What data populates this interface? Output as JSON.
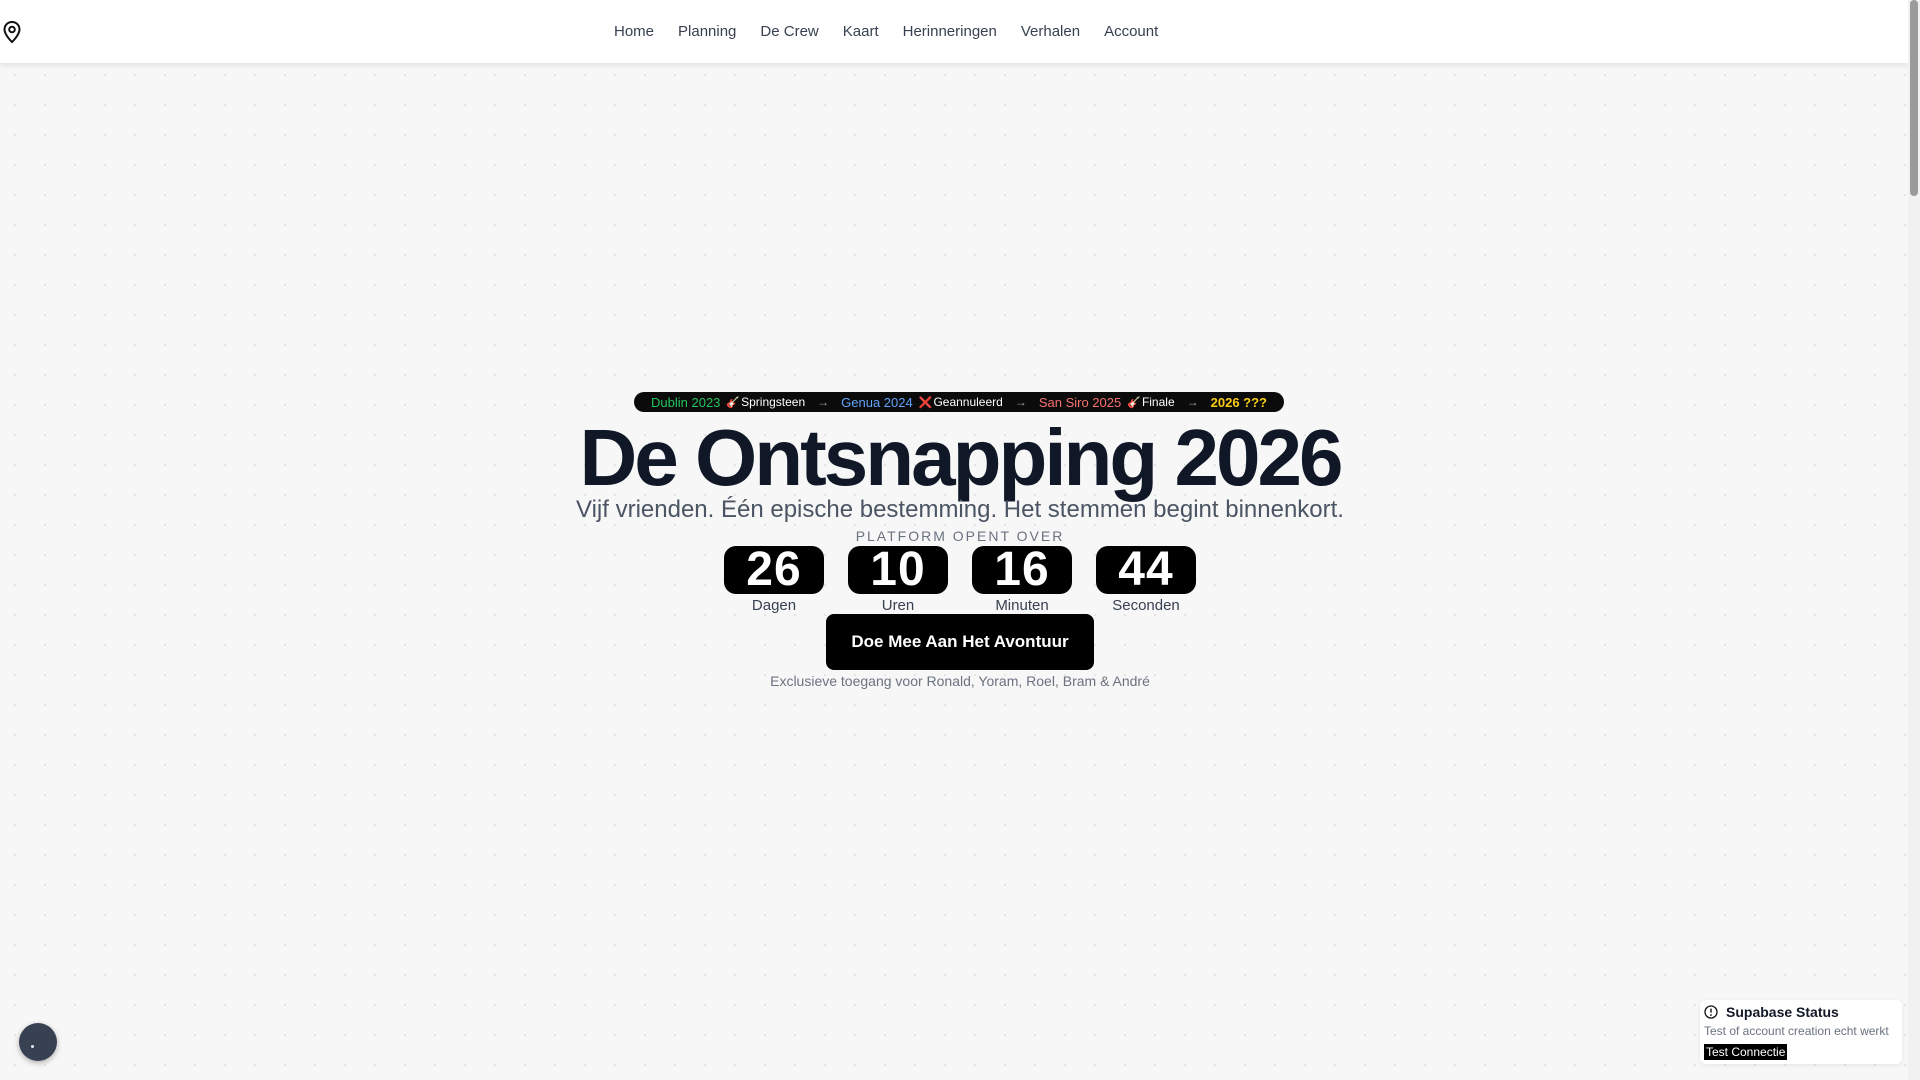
{
  "nav": {
    "items": [
      "Home",
      "Planning",
      "De Crew",
      "Kaart",
      "Herinneringen",
      "Verhalen",
      "Account"
    ]
  },
  "icons": {
    "logo": "map-pin-icon",
    "status": "info-circle-icon",
    "guitar": "🎸",
    "cross": "❌",
    "arrow": "→"
  },
  "timeline": {
    "segments": [
      {
        "place": "Dublin 2023",
        "color": "#22c55e",
        "note": "Springsteen",
        "marker": "guitar"
      },
      {
        "place": "Genua 2024",
        "color": "#60a5fa",
        "note": "Geannuleerd",
        "marker": "cross"
      },
      {
        "place": "San Siro 2025",
        "color": "#f87171",
        "note": "Finale",
        "marker": "guitar"
      },
      {
        "place": "2026 ???",
        "color": "#facc15",
        "note": "",
        "marker": ""
      }
    ]
  },
  "hero": {
    "title": "De Ontsnapping 2026",
    "subtitle": "Vijf vrienden. Één epische bestemming. Het stemmen begint binnenkort.",
    "opens_label": "PLATFORM OPENT OVER",
    "countdown": [
      {
        "value": "26",
        "label": "Dagen"
      },
      {
        "value": "10",
        "label": "Uren"
      },
      {
        "value": "16",
        "label": "Minuten"
      },
      {
        "value": "44",
        "label": "Seconden"
      }
    ],
    "cta_label": "Doe Mee Aan Het Avontuur",
    "exclusive_text": "Exclusieve toegang voor Ronald, Yoram, Roel, Bram & André"
  },
  "status_card": {
    "title": "Supabase Status",
    "description": "Test of account creation echt werkt",
    "button_label": "Test Connectie"
  },
  "colors": {
    "background": "#f7f7f7",
    "dark": "#000000",
    "title": "#101828"
  }
}
